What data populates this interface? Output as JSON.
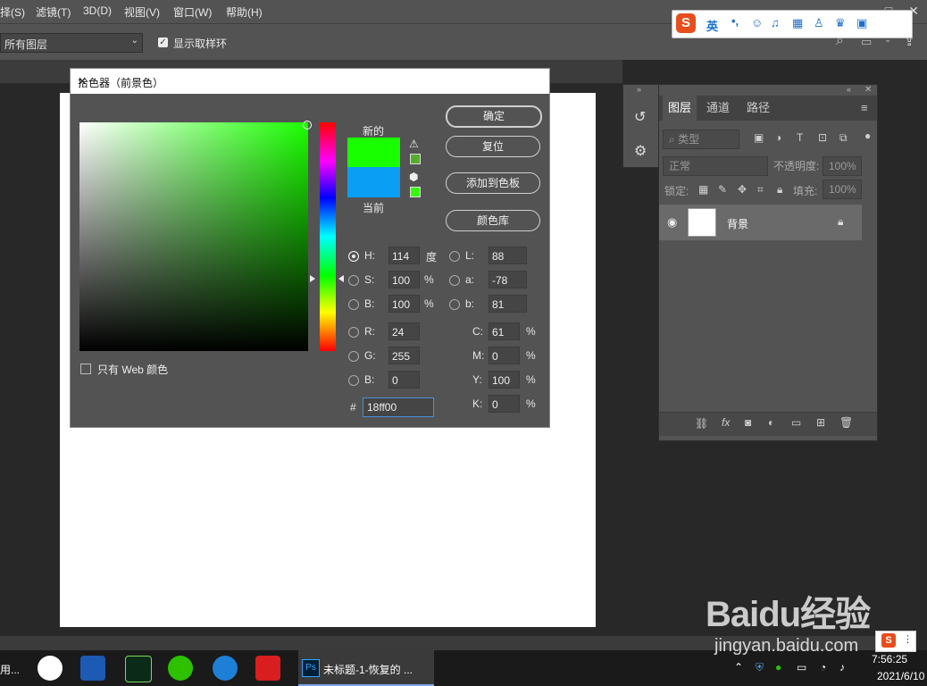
{
  "menubar": {
    "items": [
      "择(S)",
      "滤镜(T)",
      "3D(D)",
      "视图(V)",
      "窗口(W)",
      "帮助(H)"
    ],
    "minimize": "–",
    "restore": "□",
    "close": "✕"
  },
  "optionsbar": {
    "layer_select": "所有图层",
    "show_ring_label": "显示取样环"
  },
  "ime": {
    "logo": "S",
    "lang": "英",
    "punct": "•,"
  },
  "color_picker": {
    "title": "拾色器（前景色）",
    "new_label": "新的",
    "current_label": "当前",
    "new_color": "#18ff00",
    "current_color": "#0a9ef5",
    "buttons": {
      "ok": "确定",
      "reset": "复位",
      "add_swatch": "添加到色板",
      "color_libraries": "颜色库"
    },
    "only_web_label": "只有 Web 颜色",
    "hsb": {
      "h_label": "H:",
      "h_value": "114",
      "h_unit": "度",
      "s_label": "S:",
      "s_value": "100",
      "s_unit": "%",
      "b_label": "B:",
      "b_value": "100",
      "b_unit": "%"
    },
    "lab": {
      "l_label": "L:",
      "l_value": "88",
      "a_label": "a:",
      "a_value": "-78",
      "b_label": "b:",
      "b_value": "81"
    },
    "rgb": {
      "r_label": "R:",
      "r_value": "24",
      "g_label": "G:",
      "g_value": "255",
      "b_label": "B:",
      "b_value": "0"
    },
    "cmyk": {
      "c_label": "C:",
      "c_value": "61",
      "c_unit": "%",
      "m_label": "M:",
      "m_value": "0",
      "m_unit": "%",
      "y_label": "Y:",
      "y_value": "100",
      "y_unit": "%",
      "k_label": "K:",
      "k_value": "0",
      "k_unit": "%"
    },
    "hex_label": "#",
    "hex_value": "18ff00"
  },
  "layers_panel": {
    "tabs": [
      "图层",
      "通道",
      "路径"
    ],
    "filter_kind": "类型",
    "blend_mode": "正常",
    "opacity_label": "不透明度:",
    "opacity_value": "100%",
    "lock_label": "锁定:",
    "fill_label": "填充:",
    "fill_value": "100%",
    "layer_name": "背景"
  },
  "taskbar": {
    "left_text": "用...",
    "ps_label": "未标题-1-恢复的 ...",
    "time": "7:56:25",
    "date": "2021/6/10"
  },
  "watermark": {
    "brand": "Baidu经验",
    "url": "jingyan.baidu.com"
  }
}
